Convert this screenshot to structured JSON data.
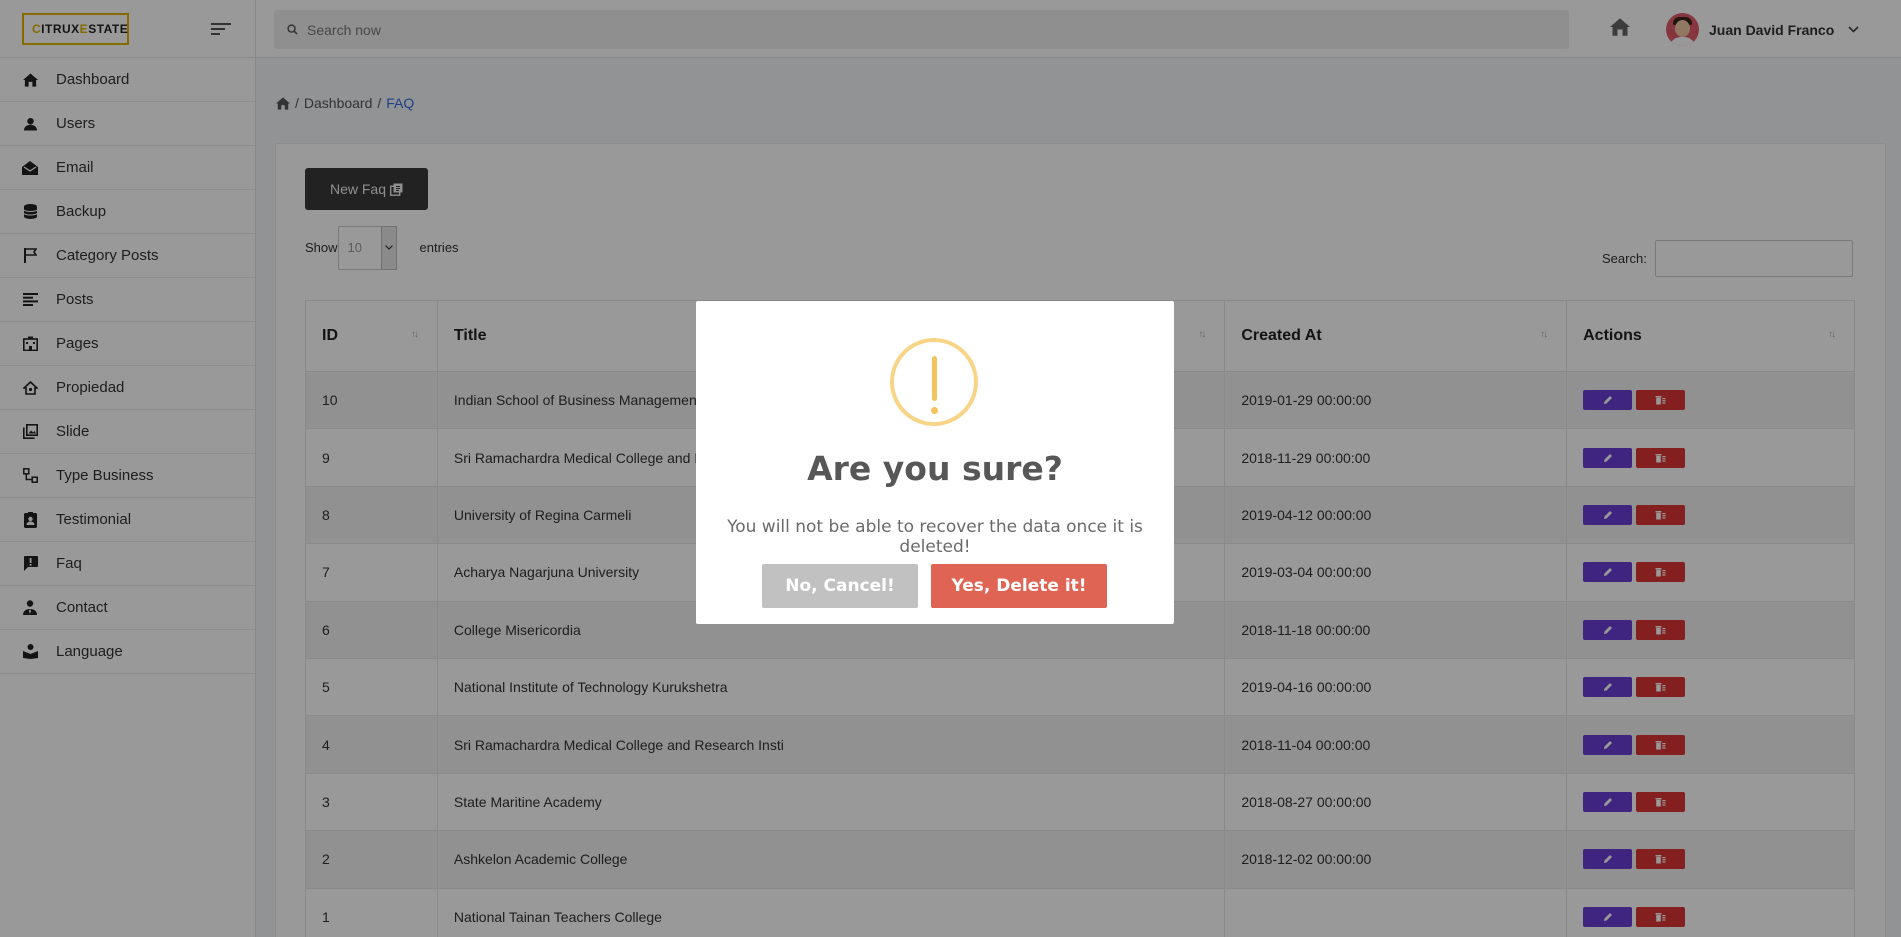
{
  "brand": {
    "initial1": "C",
    "part1": "ITRUX ",
    "initial2": "E",
    "part2": "STATE",
    "accent_color": "#e0b300"
  },
  "search": {
    "placeholder": "Search now"
  },
  "user": {
    "name": "Juan David Franco"
  },
  "sidebar": {
    "items": [
      {
        "label": "Dashboard",
        "icon": "home-icon"
      },
      {
        "label": "Users",
        "icon": "user-icon"
      },
      {
        "label": "Email",
        "icon": "envelope-open-icon"
      },
      {
        "label": "Backup",
        "icon": "database-icon"
      },
      {
        "label": "Category Posts",
        "icon": "flag-icon"
      },
      {
        "label": "Posts",
        "icon": "align-left-icon"
      },
      {
        "label": "Pages",
        "icon": "building-icon"
      },
      {
        "label": "Propiedad",
        "icon": "house-icon"
      },
      {
        "label": "Slide",
        "icon": "images-icon"
      },
      {
        "label": "Type Business",
        "icon": "sitemap-icon"
      },
      {
        "label": "Testimonial",
        "icon": "id-badge-icon"
      },
      {
        "label": "Faq",
        "icon": "comment-exclamation-icon"
      },
      {
        "label": "Contact",
        "icon": "user-tie-icon"
      },
      {
        "label": "Language",
        "icon": "book-reader-icon"
      }
    ]
  },
  "breadcrumb": {
    "sep": "/",
    "parent": "Dashboard",
    "current": "FAQ"
  },
  "toolbar": {
    "new_label": "New Faq"
  },
  "datatable": {
    "show_label": "Show",
    "page_size": "10",
    "entries_label": "entries",
    "search_label": "Search:"
  },
  "table": {
    "columns": [
      "ID",
      "Title",
      "Created At",
      "Actions"
    ],
    "rows": [
      {
        "id": "10",
        "title": "Indian School of Business Management",
        "created": "2019-01-29 00:00:00"
      },
      {
        "id": "9",
        "title": "Sri Ramachardra Medical College and Re",
        "created": "2018-11-29 00:00:00"
      },
      {
        "id": "8",
        "title": "University of Regina Carmeli",
        "created": "2019-04-12 00:00:00"
      },
      {
        "id": "7",
        "title": "Acharya Nagarjuna University",
        "created": "2019-03-04 00:00:00"
      },
      {
        "id": "6",
        "title": "College Misericordia",
        "created": "2018-11-18 00:00:00"
      },
      {
        "id": "5",
        "title": "National Institute of Technology Kurukshetra",
        "created": "2019-04-16 00:00:00"
      },
      {
        "id": "4",
        "title": "Sri Ramachardra Medical College and Research Insti",
        "created": "2018-11-04 00:00:00"
      },
      {
        "id": "3",
        "title": "State Maritine Academy",
        "created": "2018-08-27 00:00:00"
      },
      {
        "id": "2",
        "title": "Ashkelon Academic College",
        "created": "2018-12-02 00:00:00"
      },
      {
        "id": "1",
        "title": "National Tainan Teachers College",
        "created": ""
      }
    ]
  },
  "modal": {
    "title": "Are you sure?",
    "text": "You will not be able to recover the data once it is deleted!",
    "cancel_label": "No, Cancel!",
    "confirm_label": "Yes, Delete it!",
    "icon": "warning-exclamation-icon"
  },
  "colors": {
    "edit": "#6c3fd6",
    "delete": "#dc3535",
    "confirm": "#e06454",
    "cancel": "#c1c1c1",
    "link": "#2d6cdf"
  }
}
